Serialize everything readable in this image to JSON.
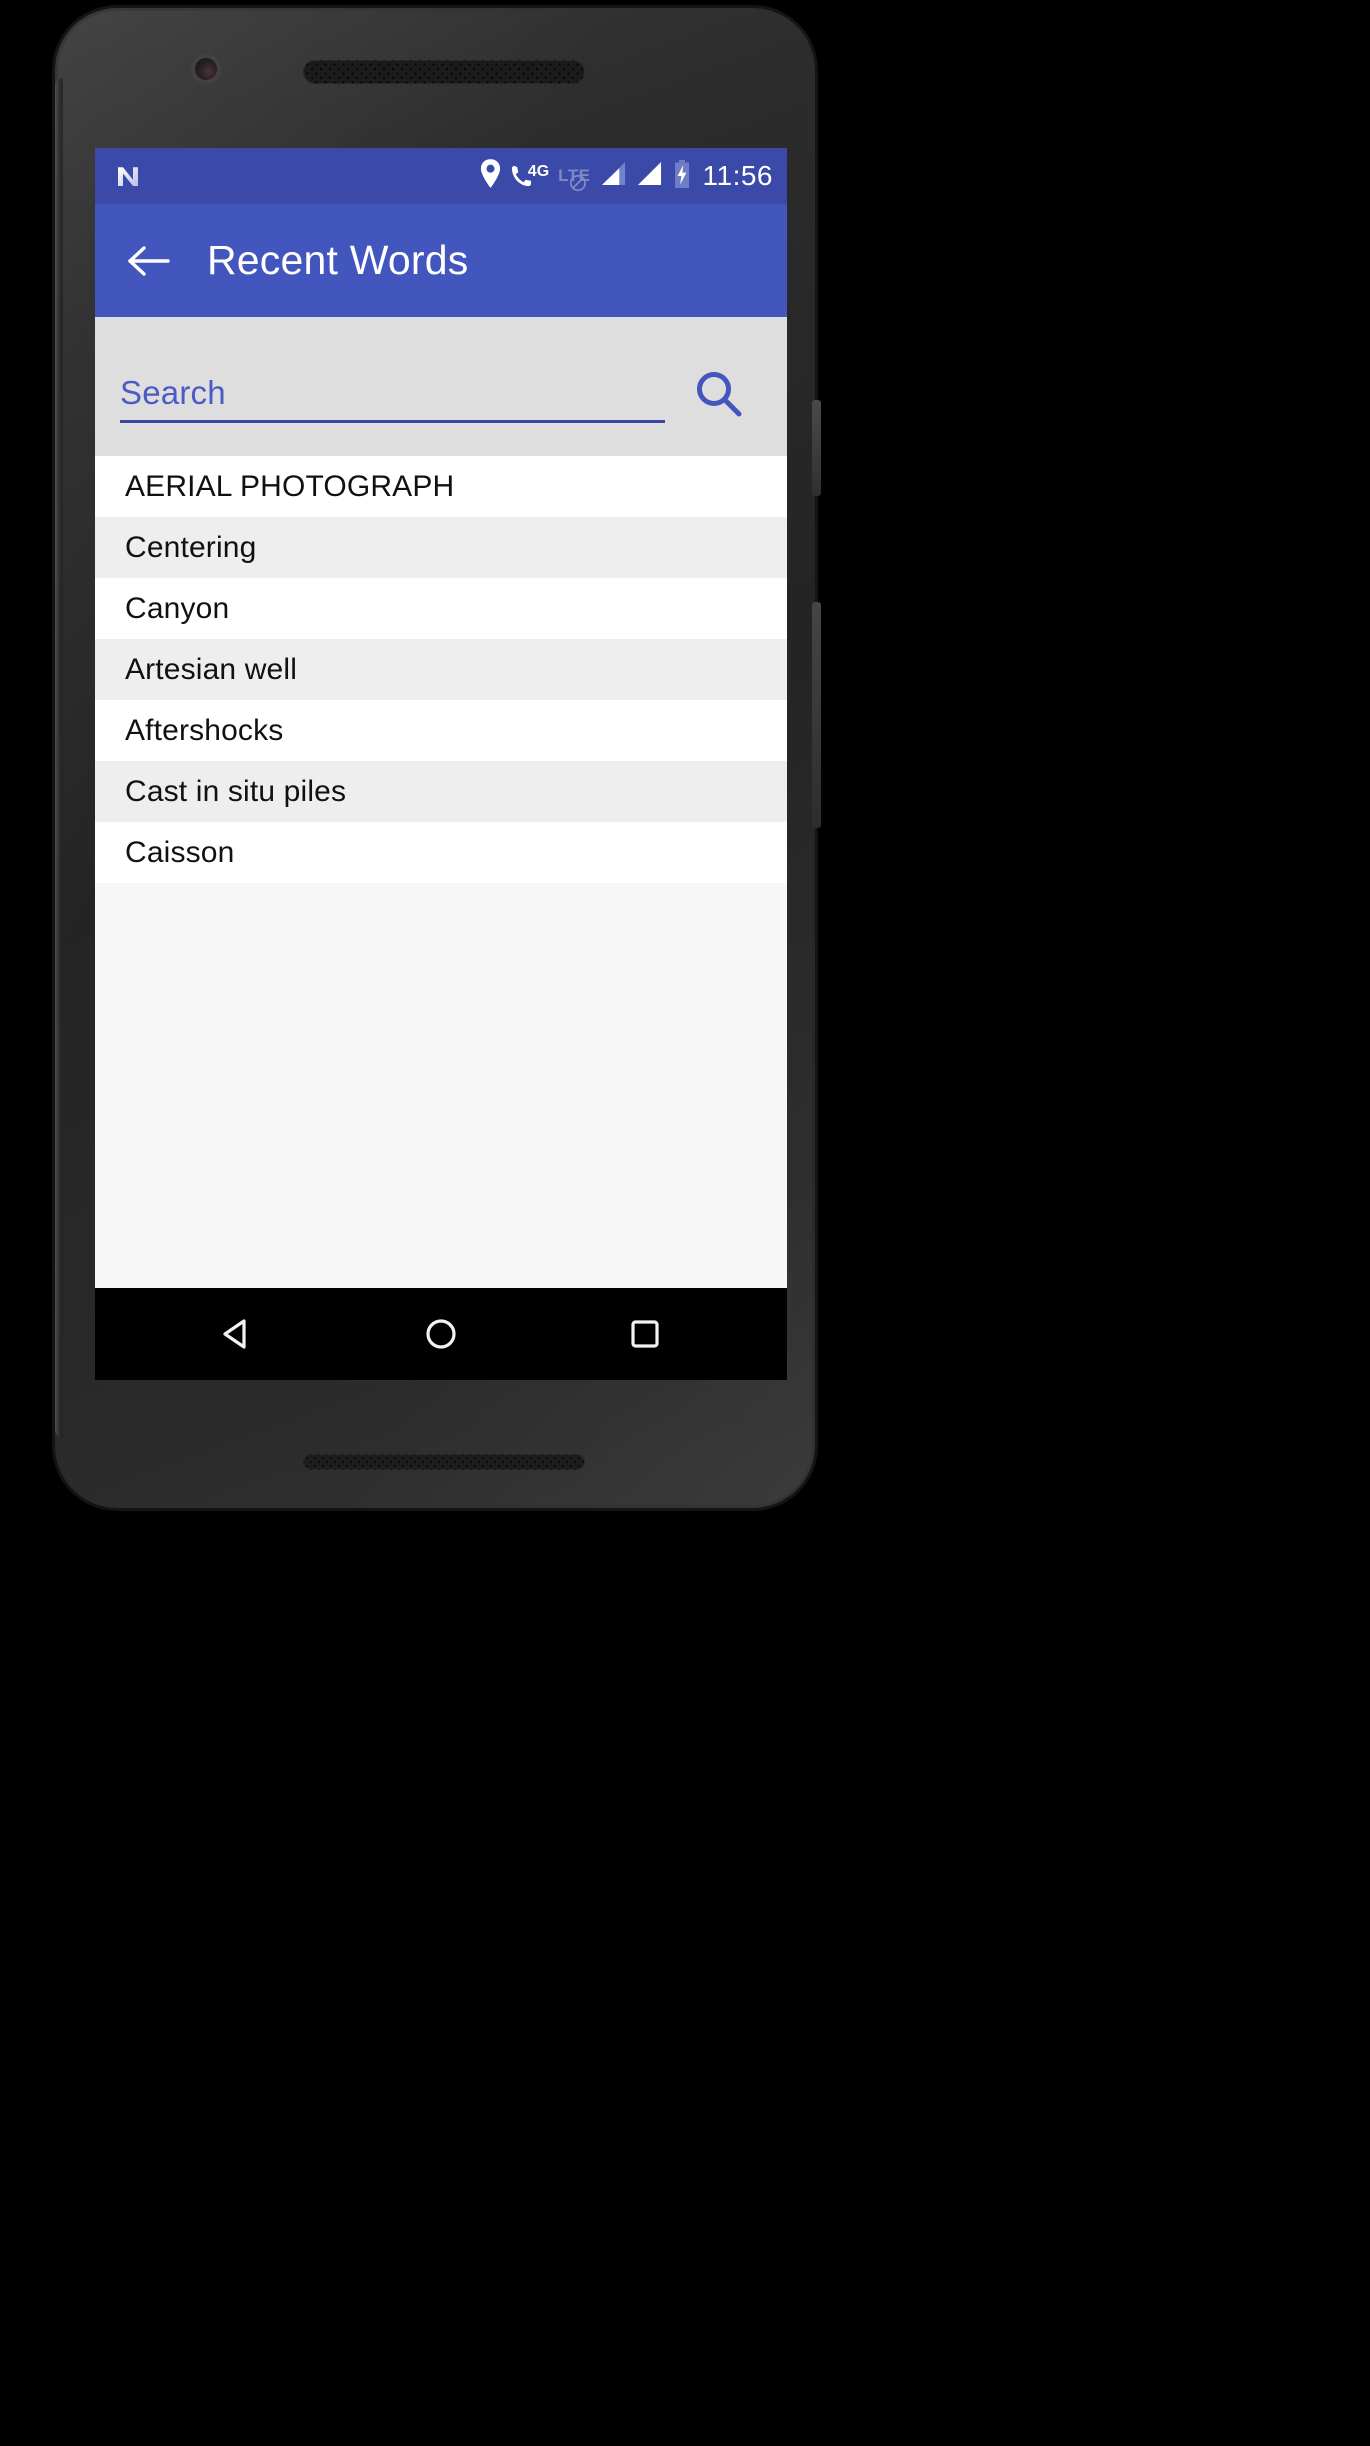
{
  "device": {
    "front_camera": "front-camera",
    "earpiece": "earpiece-speaker"
  },
  "status_bar": {
    "background": "#3b4aa8",
    "os_logo": "android-nougat-logo",
    "icons": [
      "location-pin-icon",
      "phone-4g-icon",
      "lte-no-data-icon",
      "signal-bars-icon-1",
      "signal-bars-icon-2",
      "battery-charging-icon"
    ],
    "network_label_4g": "4G",
    "network_label_lte": "LTE",
    "clock": "11:56"
  },
  "app_bar": {
    "background": "#4356bd",
    "back_label": "Back",
    "title": "Recent Words"
  },
  "search": {
    "background": "#dedede",
    "placeholder": "Search",
    "value": "",
    "accent": "#39489c",
    "search_button_label": "Search"
  },
  "list": {
    "row_bg_odd": "#ffffff",
    "row_bg_even": "#eeeeee",
    "empty_bg": "#f7f7f7",
    "items": [
      {
        "label": "AERIAL PHOTOGRAPH"
      },
      {
        "label": "Centering"
      },
      {
        "label": "Canyon"
      },
      {
        "label": "Artesian well"
      },
      {
        "label": "Aftershocks"
      },
      {
        "label": "Cast in situ piles"
      },
      {
        "label": "Caisson"
      }
    ]
  },
  "nav_bar": {
    "background": "#000000",
    "buttons": [
      {
        "name": "back",
        "label": "Back"
      },
      {
        "name": "home",
        "label": "Home"
      },
      {
        "name": "recents",
        "label": "Recent apps"
      }
    ]
  }
}
